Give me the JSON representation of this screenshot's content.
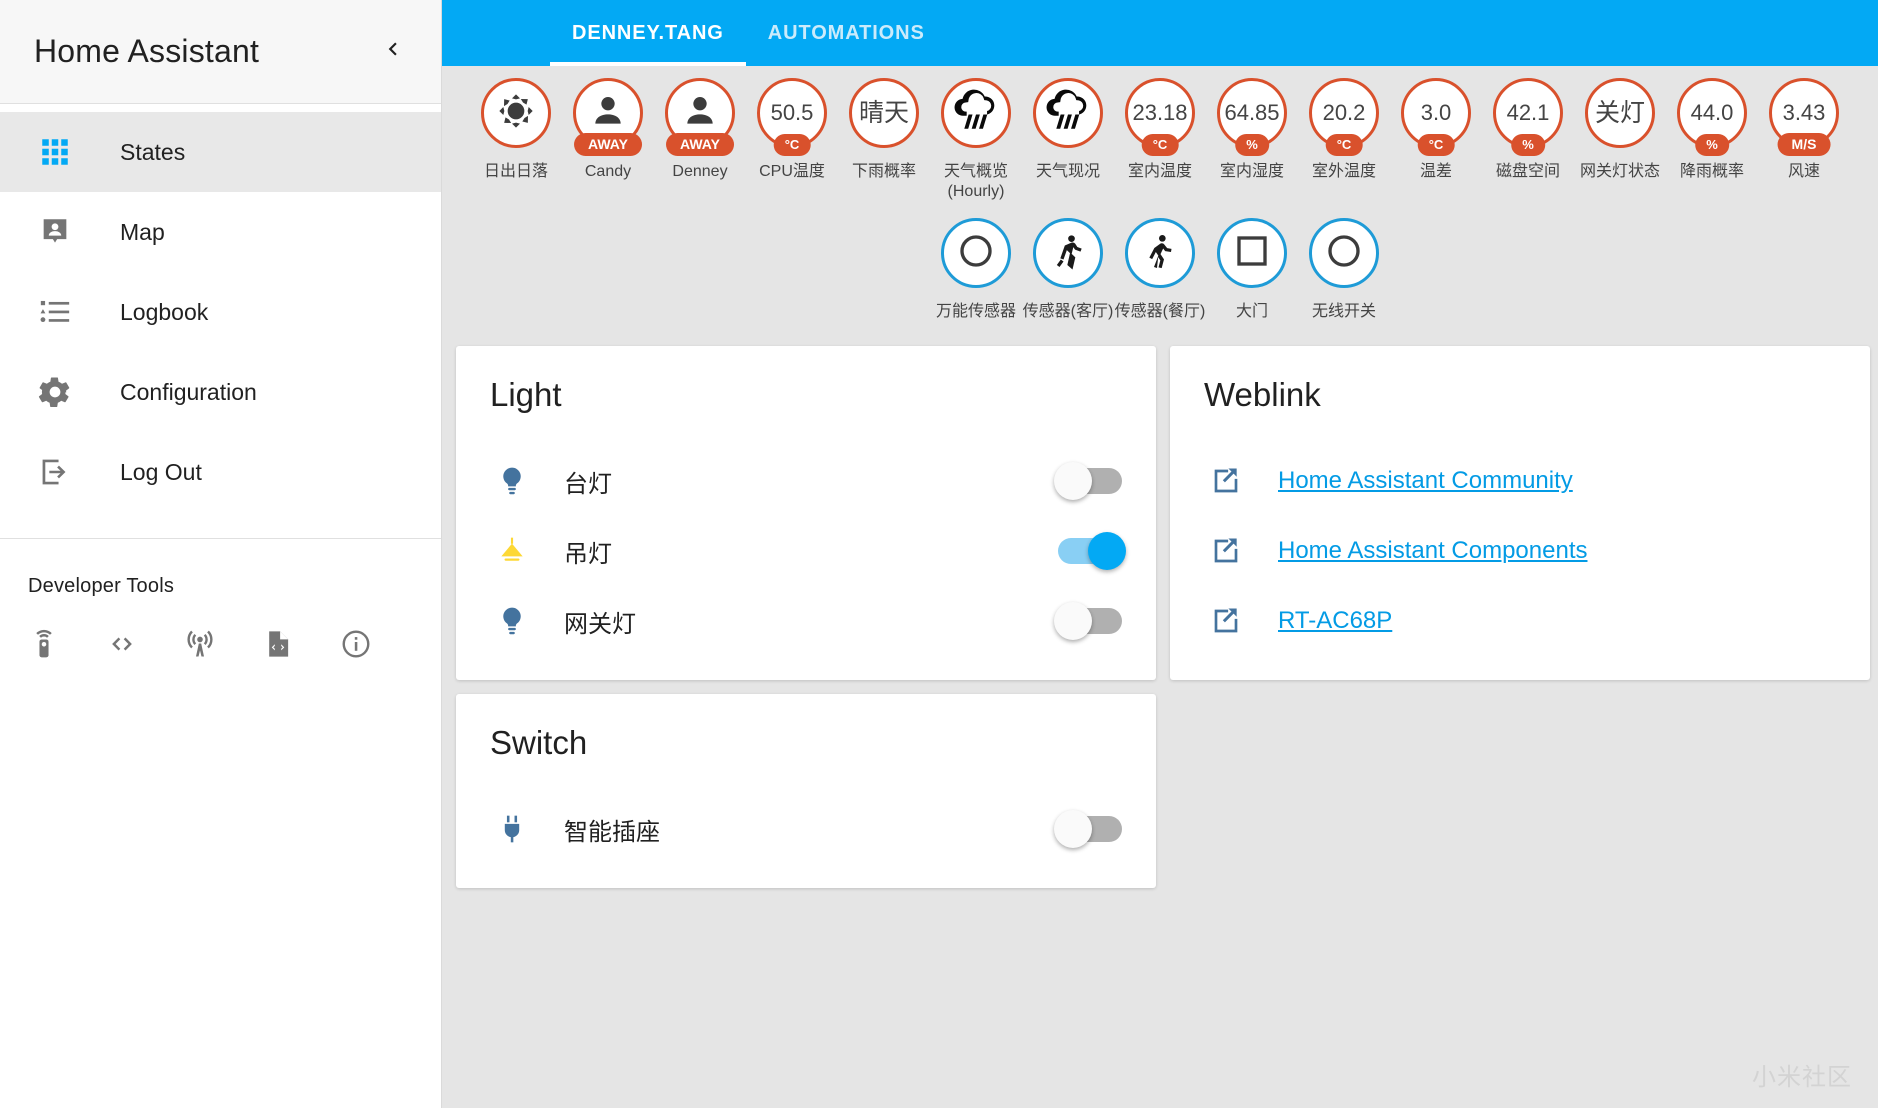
{
  "sidebar": {
    "title": "Home Assistant",
    "collapse_icon": "chevron-left-icon",
    "items": [
      {
        "label": "States",
        "icon": "grid-icon",
        "active": true
      },
      {
        "label": "Map",
        "icon": "map-marker-account-icon",
        "active": false
      },
      {
        "label": "Logbook",
        "icon": "format-list-bulleted-icon",
        "active": false
      },
      {
        "label": "Configuration",
        "icon": "gear-icon",
        "active": false
      },
      {
        "label": "Log Out",
        "icon": "logout-icon",
        "active": false
      }
    ],
    "devtools_title": "Developer Tools",
    "devtools": [
      {
        "icon": "remote-icon",
        "name": "services"
      },
      {
        "icon": "code-brackets-icon",
        "name": "templates"
      },
      {
        "icon": "broadcast-icon",
        "name": "events"
      },
      {
        "icon": "file-code-icon",
        "name": "states"
      },
      {
        "icon": "info-icon",
        "name": "info"
      }
    ]
  },
  "toolbar": {
    "tabs": [
      {
        "label": "DENNEY.TANG",
        "active": true
      },
      {
        "label": "AUTOMATIONS",
        "active": false
      }
    ]
  },
  "badges": {
    "row1": [
      {
        "label": "日出日落",
        "icon": "sun-icon",
        "value": null,
        "unit": null,
        "color": "#D9512C"
      },
      {
        "label": "Candy",
        "icon": "account-icon",
        "value": null,
        "unit": "AWAY",
        "color": "#D9512C"
      },
      {
        "label": "Denney",
        "icon": "account-icon",
        "value": null,
        "unit": "AWAY",
        "color": "#D9512C"
      },
      {
        "label": "CPU温度",
        "icon": null,
        "value": "50.5",
        "unit": "°C",
        "color": "#D9512C"
      },
      {
        "label": "下雨概率",
        "icon": null,
        "value": "晴天",
        "unit": null,
        "color": "#D9512C"
      },
      {
        "label": "天气概览 (Hourly)",
        "icon": "weather-pouring-icon",
        "value": null,
        "unit": null,
        "color": "#D9512C"
      },
      {
        "label": "天气现况",
        "icon": "weather-pouring-icon",
        "value": null,
        "unit": null,
        "color": "#D9512C"
      },
      {
        "label": "室内温度",
        "icon": null,
        "value": "23.18",
        "unit": "°C",
        "color": "#D9512C"
      },
      {
        "label": "室内湿度",
        "icon": null,
        "value": "64.85",
        "unit": "%",
        "color": "#D9512C"
      },
      {
        "label": "室外温度",
        "icon": null,
        "value": "20.2",
        "unit": "°C",
        "color": "#D9512C"
      },
      {
        "label": "温差",
        "icon": null,
        "value": "3.0",
        "unit": "°C",
        "color": "#D9512C"
      },
      {
        "label": "磁盘空间",
        "icon": null,
        "value": "42.1",
        "unit": "%",
        "color": "#D9512C"
      },
      {
        "label": "网关灯状态",
        "icon": null,
        "value": "关灯",
        "unit": null,
        "color": "#D9512C"
      },
      {
        "label": "降雨概率",
        "icon": null,
        "value": "44.0",
        "unit": "%",
        "color": "#D9512C"
      },
      {
        "label": "风速",
        "icon": null,
        "value": "3.43",
        "unit": "M/S",
        "color": "#D9512C"
      }
    ],
    "row2": [
      {
        "label": "万能传感器",
        "icon": "circle-outline-icon",
        "color": "#1E9BD7"
      },
      {
        "label": "传感器(客厅)",
        "icon": "run-icon",
        "color": "#1E9BD7"
      },
      {
        "label": "传感器(餐厅)",
        "icon": "walk-icon",
        "color": "#1E9BD7"
      },
      {
        "label": "大门",
        "icon": "square-outline-icon",
        "color": "#1E9BD7"
      },
      {
        "label": "无线开关",
        "icon": "circle-outline-icon",
        "color": "#1E9BD7"
      }
    ]
  },
  "cards": {
    "light": {
      "title": "Light",
      "rows": [
        {
          "name": "台灯",
          "icon": "lightbulb-icon",
          "icon_color": "#44739E",
          "state": "off"
        },
        {
          "name": "吊灯",
          "icon": "ceiling-light-icon",
          "icon_color": "#FDD835",
          "state": "on"
        },
        {
          "name": "网关灯",
          "icon": "lightbulb-icon",
          "icon_color": "#44739E",
          "state": "off"
        }
      ]
    },
    "switch": {
      "title": "Switch",
      "rows": [
        {
          "name": "智能插座",
          "icon": "power-plug-icon",
          "icon_color": "#44739E",
          "state": "off"
        }
      ]
    },
    "weblink": {
      "title": "Weblink",
      "rows": [
        {
          "text": "Home Assistant Community",
          "icon": "open-in-new-icon"
        },
        {
          "text": "Home Assistant Components",
          "icon": "open-in-new-icon"
        },
        {
          "text": "RT-AC68P",
          "icon": "open-in-new-icon"
        }
      ]
    }
  },
  "watermark": "小米社区",
  "colors": {
    "toolbar": "#03A9F4",
    "badge_border": "#D9512C",
    "badge_border_blue": "#1E9BD7",
    "link": "#039BE5",
    "background": "#E5E5E5"
  }
}
